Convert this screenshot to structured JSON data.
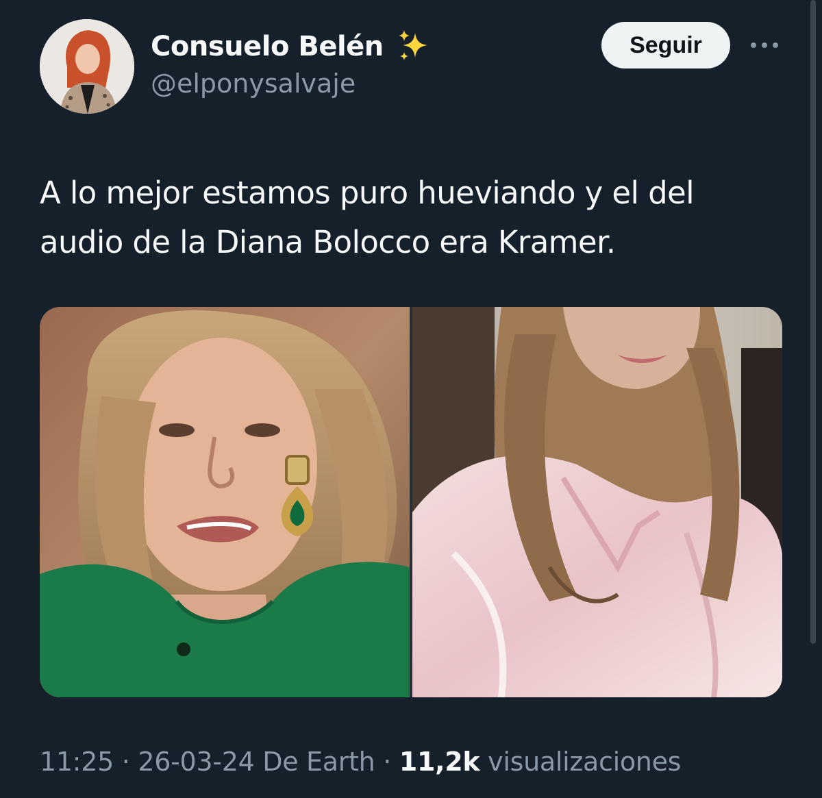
{
  "author": {
    "display_name": "Consuelo Belén",
    "badge_emoji": "sparkles",
    "handle": "@elponysalvaje"
  },
  "actions": {
    "follow_label": "Seguir",
    "more_icon": "more-horizontal-icon"
  },
  "tweet": {
    "text_lines": [
      "A lo mejor estamos puro hueviando y el del",
      "audio de la Diana Bolocco era Kramer."
    ]
  },
  "media": {
    "photos": [
      {
        "description_icon": "photo-left"
      },
      {
        "description_icon": "photo-right"
      }
    ]
  },
  "meta": {
    "time": "11:25",
    "separator": "·",
    "date": "26-03-24",
    "source": "De Earth",
    "views_count": "11,2k",
    "views_label": "visualizaciones"
  },
  "colors": {
    "background": "#15202b",
    "text_primary": "#f7f9f9",
    "text_secondary": "#8b98a5",
    "follow_bg": "#eff3f4"
  }
}
